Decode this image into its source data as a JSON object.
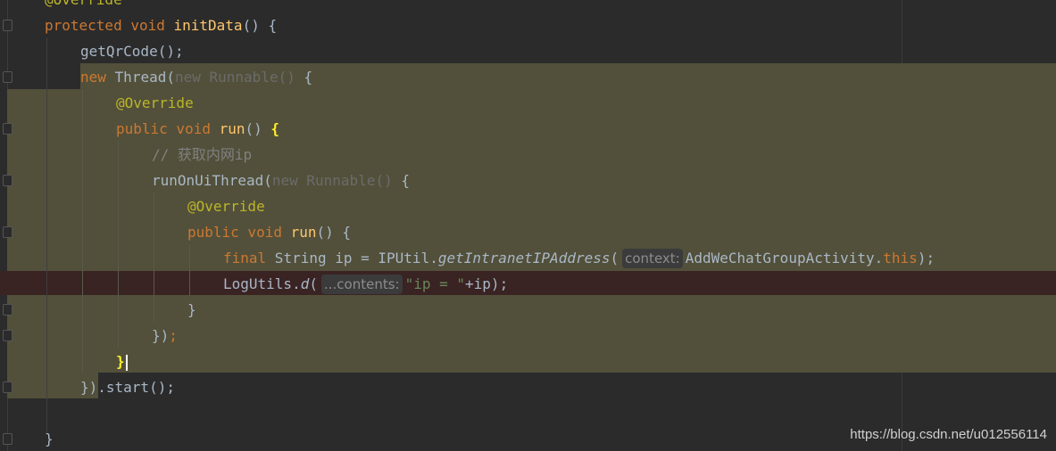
{
  "editor": {
    "lines": {
      "l0": {
        "annotation": "@Override"
      },
      "l1": {
        "kw": "protected void",
        "name": "initData",
        "rest": "() {"
      },
      "l2": {
        "call": "getQrCode();"
      },
      "l3": {
        "kw": "new",
        "cls": "Thread(",
        "dim": "new Runnable()",
        "rest": " {"
      },
      "l4": {
        "annotation": "@Override"
      },
      "l5": {
        "kw": "public void",
        "name": "run",
        "rest": "() ",
        "brace": "{"
      },
      "l6": {
        "comment": "// 获取内网ip"
      },
      "l7": {
        "call": "runOnUiThread(",
        "dim": "new Runnable()",
        "rest": " {"
      },
      "l8": {
        "annotation": "@Override"
      },
      "l9": {
        "kw": "public void",
        "name": "run",
        "rest": "() {"
      },
      "l10": {
        "kw": "final",
        "type": " String ip = IPUtil.",
        "method": "getIntranetIPAddress",
        "open": "(",
        "hint": "context:",
        "arg": "AddWeChatGroupActivity.",
        "kwthis": "this",
        "close": ");"
      },
      "l11": {
        "obj": "LogUtils.",
        "method": "d",
        "open": "(",
        "hint": "...contents:",
        "str": "\"ip = \"",
        "close": "+ip);"
      },
      "l12": {
        "brace": "}"
      },
      "l13": {
        "brace": "})",
        "semi": ";"
      },
      "l14": {
        "brace": "}"
      },
      "l15": {
        "brace": "})",
        "rest": ".start();"
      },
      "l16": {
        "brace": "}"
      }
    }
  },
  "watermark": "https://blog.csdn.net/u012556114",
  "colors": {
    "background": "#2b2b2b",
    "highlight": "#52503a",
    "keyword": "#cc7832",
    "function": "#ffc66d",
    "annotation": "#bbb529",
    "string": "#6a8759"
  }
}
